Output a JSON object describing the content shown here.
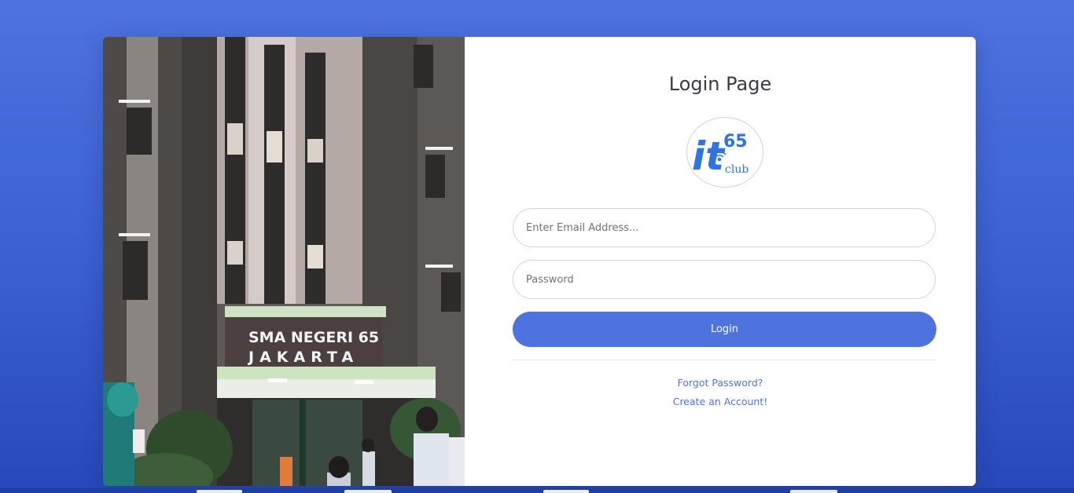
{
  "login": {
    "title": "Login Page",
    "email_placeholder": "Enter Email Address...",
    "password_placeholder": "Password",
    "login_label": "Login",
    "forgot_password": "Forgot Password?",
    "create_account": "Create an Account!"
  },
  "logo": {
    "text_it": "it",
    "text_number": "65",
    "text_club": "club"
  },
  "photo": {
    "sign_line1": "SMA NEGERI 65",
    "sign_line2": "JAKARTA"
  },
  "colors": {
    "background": "#4e73df",
    "primary": "#4e73df",
    "card": "#ffffff",
    "logo_blue": "#2f74e0"
  },
  "icons": [
    "wifi-icon"
  ]
}
